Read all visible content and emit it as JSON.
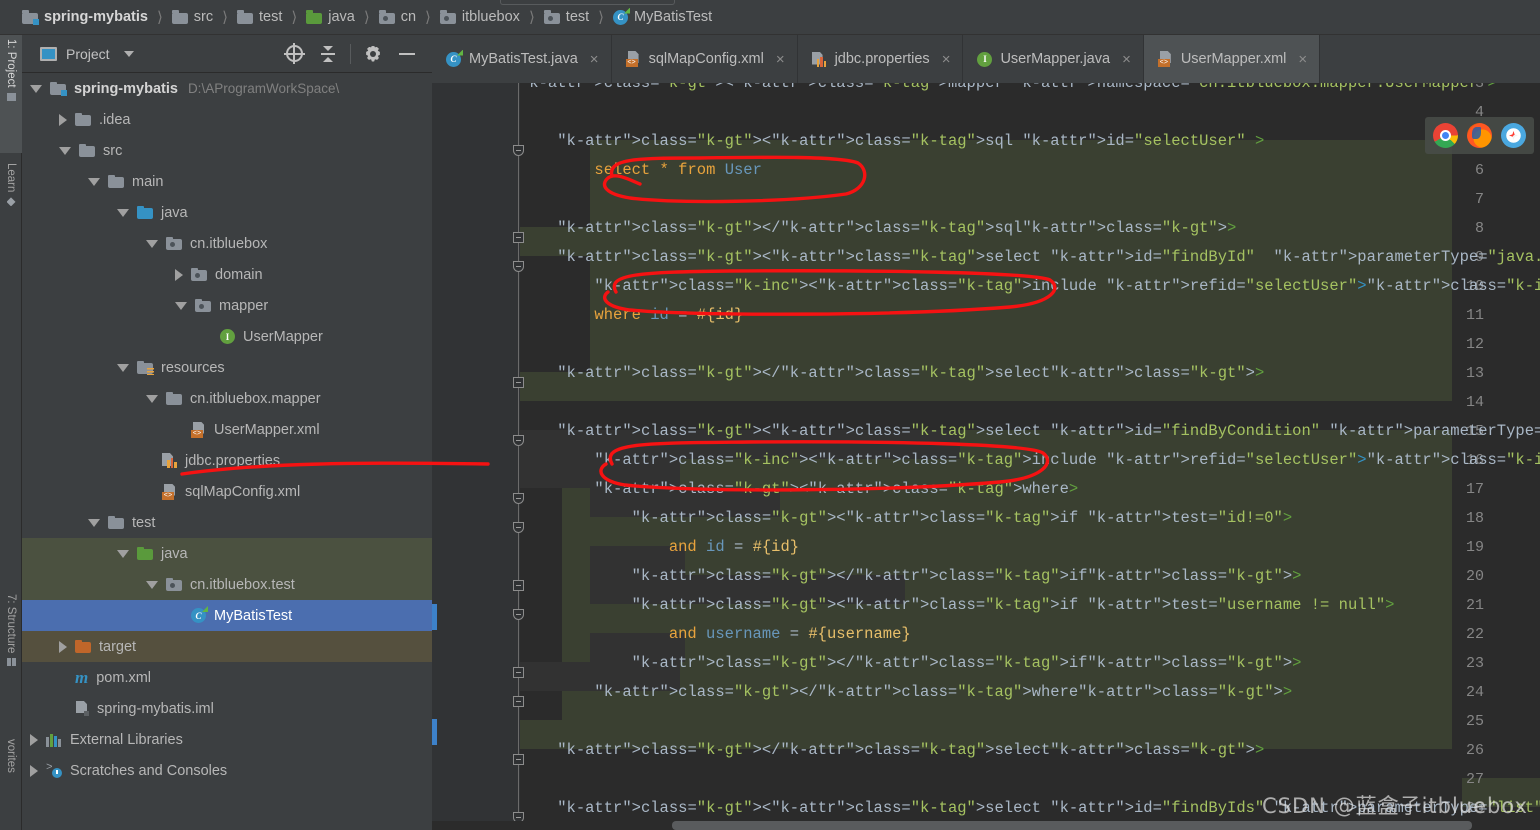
{
  "breadcrumb": [
    {
      "label": "spring-mybatis",
      "icon": "folder-module-icon",
      "bold": true
    },
    {
      "label": "src",
      "icon": "folder-icon",
      "bold": false
    },
    {
      "label": "test",
      "icon": "folder-icon",
      "bold": false
    },
    {
      "label": "java",
      "icon": "folder-green-icon",
      "bold": false
    },
    {
      "label": "cn",
      "icon": "package-icon",
      "bold": false
    },
    {
      "label": "itbluebox",
      "icon": "package-icon",
      "bold": false
    },
    {
      "label": "test",
      "icon": "package-icon",
      "bold": false
    },
    {
      "label": "MyBatisTest",
      "icon": "java-class-icon",
      "bold": false
    }
  ],
  "toolstrip": {
    "tabs": [
      {
        "label": "1: Project",
        "icon": "project-icon",
        "active": true
      },
      {
        "label": "Learn",
        "icon": "learn-icon",
        "active": false
      },
      {
        "label": "7: Structure",
        "icon": "structure-icon",
        "active": false
      },
      {
        "label": "vorites",
        "icon": "favorites-icon",
        "active": false
      }
    ]
  },
  "project_panel": {
    "title": "Project",
    "actions": [
      {
        "name": "select-opened-file-button",
        "icon": "target-icon"
      },
      {
        "name": "collapse-all-button",
        "icon": "collapse-all-icon"
      },
      {
        "name": "settings-button",
        "icon": "gear-icon"
      },
      {
        "name": "hide-button",
        "icon": "minus-icon"
      }
    ],
    "tree": [
      {
        "label": "spring-mybatis",
        "path": "D:\\AProgramWorkSpace\\",
        "indent": 0,
        "state": "open",
        "icon": "module-icon",
        "bold": true,
        "bg": "none"
      },
      {
        "label": ".idea",
        "path": "",
        "indent": 1,
        "state": "closed",
        "icon": "folder-icon",
        "bold": false,
        "bg": "none"
      },
      {
        "label": "src",
        "path": "",
        "indent": 1,
        "state": "open",
        "icon": "folder-icon",
        "bold": false,
        "bg": "none"
      },
      {
        "label": "main",
        "path": "",
        "indent": 2,
        "state": "open",
        "icon": "folder-icon",
        "bold": false,
        "bg": "none"
      },
      {
        "label": "java",
        "path": "",
        "indent": 3,
        "state": "open",
        "icon": "folder-blue-icon",
        "bold": false,
        "bg": "none"
      },
      {
        "label": "cn.itbluebox",
        "path": "",
        "indent": 4,
        "state": "open",
        "icon": "package-icon",
        "bold": false,
        "bg": "none"
      },
      {
        "label": "domain",
        "path": "",
        "indent": 5,
        "state": "closed",
        "icon": "package-icon",
        "bold": false,
        "bg": "none"
      },
      {
        "label": "mapper",
        "path": "",
        "indent": 5,
        "state": "open",
        "icon": "package-icon",
        "bold": false,
        "bg": "none"
      },
      {
        "label": "UserMapper",
        "path": "",
        "indent": 6,
        "state": "leaf",
        "icon": "java-interface-icon",
        "bold": false,
        "bg": "none"
      },
      {
        "label": "resources",
        "path": "",
        "indent": 3,
        "state": "open",
        "icon": "resources-icon",
        "bold": false,
        "bg": "none"
      },
      {
        "label": "cn.itbluebox.mapper",
        "path": "",
        "indent": 4,
        "state": "open",
        "icon": "folder-icon",
        "bold": false,
        "bg": "none"
      },
      {
        "label": "UserMapper.xml",
        "path": "",
        "indent": 5,
        "state": "leaf",
        "icon": "xml-file-icon",
        "bold": false,
        "bg": "none"
      },
      {
        "label": "jdbc.properties",
        "path": "",
        "indent": 4,
        "state": "leaf",
        "icon": "properties-file-icon",
        "bold": false,
        "bg": "none"
      },
      {
        "label": "sqlMapConfig.xml",
        "path": "",
        "indent": 4,
        "state": "leaf",
        "icon": "xml-file-icon",
        "bold": false,
        "bg": "none"
      },
      {
        "label": "test",
        "path": "",
        "indent": 2,
        "state": "open",
        "icon": "folder-icon",
        "bold": false,
        "bg": "none"
      },
      {
        "label": "java",
        "path": "",
        "indent": 3,
        "state": "open",
        "icon": "folder-green-icon",
        "bold": false,
        "bg": "green"
      },
      {
        "label": "cn.itbluebox.test",
        "path": "",
        "indent": 4,
        "state": "open",
        "icon": "package-icon",
        "bold": false,
        "bg": "green"
      },
      {
        "label": "MyBatisTest",
        "path": "",
        "indent": 5,
        "state": "leaf",
        "icon": "java-class-icon",
        "bold": false,
        "bg": "selected"
      },
      {
        "label": "target",
        "path": "",
        "indent": 1,
        "state": "closed",
        "icon": "folder-orange-icon",
        "bold": false,
        "bg": "brown"
      },
      {
        "label": "pom.xml",
        "path": "",
        "indent": 1,
        "state": "leaf",
        "icon": "maven-icon",
        "bold": false,
        "bg": "none"
      },
      {
        "label": "spring-mybatis.iml",
        "path": "",
        "indent": 1,
        "state": "leaf",
        "icon": "iml-file-icon",
        "bold": false,
        "bg": "none"
      },
      {
        "label": "External Libraries",
        "path": "",
        "indent": 0,
        "state": "closed",
        "icon": "libraries-icon",
        "bold": false,
        "bg": "none"
      },
      {
        "label": "Scratches and Consoles",
        "path": "",
        "indent": 0,
        "state": "closed",
        "icon": "scratches-icon",
        "bold": false,
        "bg": "none"
      }
    ]
  },
  "editor_tabs": [
    {
      "label": "MyBatisTest.java",
      "icon": "java-class-icon",
      "active": false,
      "close": "×"
    },
    {
      "label": "sqlMapConfig.xml",
      "icon": "xml-file-icon",
      "active": false,
      "close": "×"
    },
    {
      "label": "jdbc.properties",
      "icon": "properties-file-icon",
      "active": false,
      "close": "×"
    },
    {
      "label": "UserMapper.java",
      "icon": "java-interface-icon",
      "active": false,
      "close": "×"
    },
    {
      "label": "UserMapper.xml",
      "icon": "xml-file-icon",
      "active": true,
      "close": "×"
    }
  ],
  "editor": {
    "first_visible_line": 3,
    "line_numbers": [
      3,
      4,
      5,
      6,
      7,
      8,
      9,
      10,
      11,
      12,
      13,
      14,
      15,
      16,
      17,
      18,
      19,
      20,
      21,
      22,
      23,
      24,
      25,
      26,
      27,
      28
    ],
    "lines": [
      {
        "n": 3,
        "text": "<mapper namespace=\"cn.itbluebox.mapper.UserMapper\">"
      },
      {
        "n": 4,
        "text": ""
      },
      {
        "n": 5,
        "text": "    <sql id=\"selectUser\" >"
      },
      {
        "n": 6,
        "text": "        select * from User"
      },
      {
        "n": 7,
        "text": ""
      },
      {
        "n": 8,
        "text": "    </sql>"
      },
      {
        "n": 9,
        "text": "    <select id=\"findById\"  parameterType=\"java.lang.Integer\" resultType=\"cn.itbluebox.domain.User\">"
      },
      {
        "n": 10,
        "text": "        <include refid=\"selectUser\"></include>"
      },
      {
        "n": 11,
        "text": "        where id = #{id}"
      },
      {
        "n": 12,
        "text": ""
      },
      {
        "n": 13,
        "text": "    </select>"
      },
      {
        "n": 14,
        "text": ""
      },
      {
        "n": 15,
        "text": "    <select id=\"findByCondition\" parameterType=\"cn.itbluebox.domain.User\" resultType=\"cn.itbluebox.domain.User\">"
      },
      {
        "n": 16,
        "text": "        <include refid=\"selectUser\"></include>"
      },
      {
        "n": 17,
        "text": "        <where>"
      },
      {
        "n": 18,
        "text": "            <if test=\"id!=0\">"
      },
      {
        "n": 19,
        "text": "                and id = #{id}"
      },
      {
        "n": 20,
        "text": "            </if>"
      },
      {
        "n": 21,
        "text": "            <if test=\"username != null\">"
      },
      {
        "n": 22,
        "text": "                and username = #{username}"
      },
      {
        "n": 23,
        "text": "            </if>"
      },
      {
        "n": 24,
        "text": "        </where>"
      },
      {
        "n": 25,
        "text": ""
      },
      {
        "n": 26,
        "text": "    </select>"
      },
      {
        "n": 27,
        "text": ""
      },
      {
        "n": 28,
        "text": "    <select id=\"findByIds\" parameterType=\"list\" resultType=\"cn.itbluebox.domain.User\">"
      }
    ]
  },
  "browsers": [
    {
      "name": "chrome-icon"
    },
    {
      "name": "firefox-icon"
    },
    {
      "name": "safari-icon"
    }
  ],
  "annotations": {
    "ellipse_1_target": "select * from User",
    "ellipse_2_target": "<include refid=\"selectUser\"></include> (line 10)",
    "ellipse_3_target": "<include refid=\"selectUser\"></include> (line 16)",
    "line_marker_target": "line 16",
    "color": "#f61212"
  },
  "watermark": "CSDN @蓝盒子itbluebox"
}
